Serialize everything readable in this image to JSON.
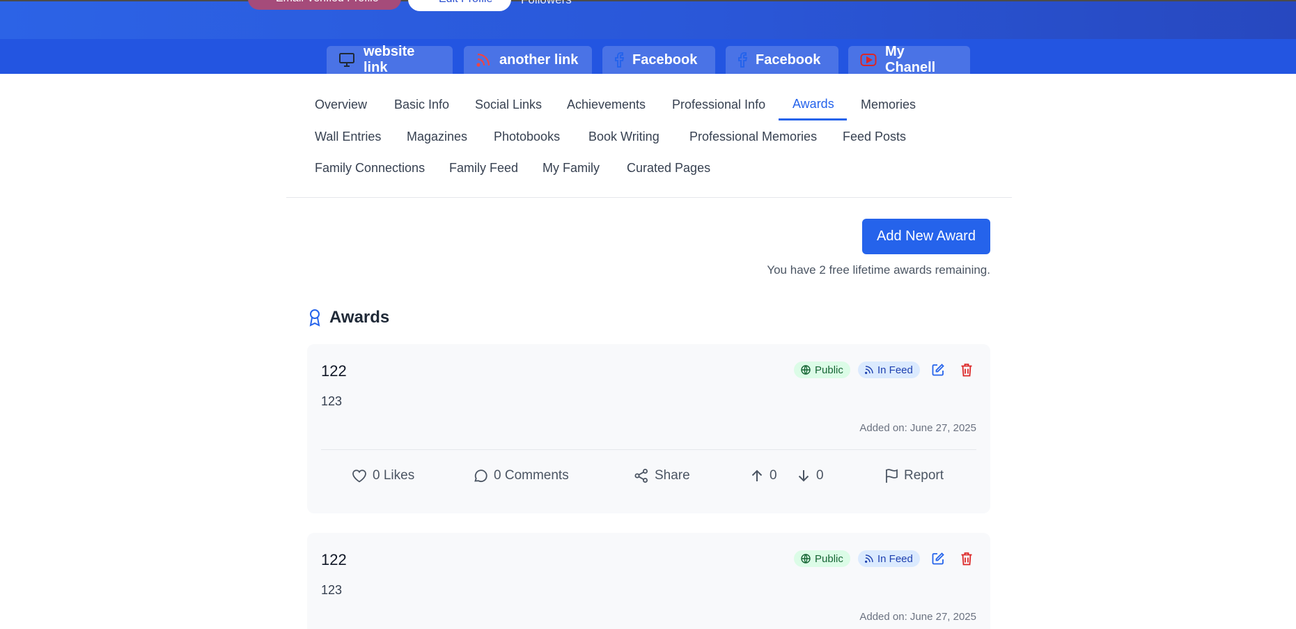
{
  "header": {
    "verified_label": "Email Verified Profile",
    "edit_label": "Edit Profile",
    "followers_label": "Followers"
  },
  "social_links": [
    {
      "label": "website link",
      "icon": "monitor-icon",
      "color": "#1f2937"
    },
    {
      "label": "another link",
      "icon": "rss-icon",
      "color": "#ef4444"
    },
    {
      "label": "Facebook",
      "icon": "facebook-icon",
      "color": "#2563eb"
    },
    {
      "label": "Facebook",
      "icon": "facebook-icon",
      "color": "#2563eb"
    },
    {
      "label": "My Chanell",
      "icon": "youtube-icon",
      "color": "#dc2626"
    }
  ],
  "tabs": {
    "overview": "Overview",
    "basic_info": "Basic Info",
    "social_links": "Social Links",
    "achievements": "Achievements",
    "professional_info": "Professional Info",
    "awards": "Awards",
    "memories": "Memories",
    "wall_entries": "Wall Entries",
    "magazines": "Magazines",
    "photobooks": "Photobooks",
    "book_writing": "Book Writing",
    "professional_memories": "Professional Memories",
    "feed_posts": "Feed Posts",
    "family_connections": "Family Connections",
    "family_feed": "Family Feed",
    "my_family": "My Family",
    "curated_pages": "Curated Pages",
    "active": "Awards"
  },
  "awards_page": {
    "add_button": "Add New Award",
    "remaining_text": "You have 2 free lifetime awards remaining.",
    "section_title": "Awards"
  },
  "colors": {
    "primary": "#2563eb",
    "public_badge_bg": "#dcfce7",
    "feed_badge_bg": "#dbeafe",
    "delete": "#dc2626"
  },
  "awards": [
    {
      "title": "122",
      "description": "123",
      "visibility": "Public",
      "feed": "In Feed",
      "date": "Added on: June 27, 2025",
      "likes": "0 Likes",
      "comments": "0 Comments",
      "share": "Share",
      "upvotes": "0",
      "downvotes": "0",
      "report": "Report"
    },
    {
      "title": "122",
      "description": "123",
      "visibility": "Public",
      "feed": "In Feed",
      "date": "Added on: June 27, 2025"
    }
  ]
}
